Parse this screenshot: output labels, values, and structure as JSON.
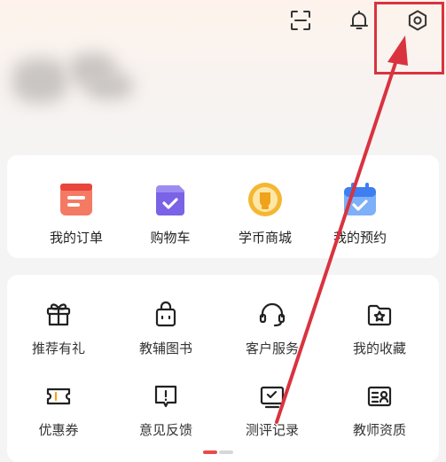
{
  "icons": {
    "scan": "scan-icon",
    "bell": "bell-icon",
    "gear": "gear-icon"
  },
  "orders": [
    {
      "label": "我的订单",
      "icon": "order-icon",
      "color": "#e8453c"
    },
    {
      "label": "购物车",
      "icon": "cart-icon",
      "color": "#7a63e6"
    },
    {
      "label": "学币商城",
      "icon": "coin-icon",
      "color": "#f2a31b"
    },
    {
      "label": "我的预约",
      "icon": "calendar-icon",
      "color": "#3d7ff1"
    }
  ],
  "services": [
    {
      "label": "推荐有礼",
      "icon": "gift-icon"
    },
    {
      "label": "教辅图书",
      "icon": "bag-icon"
    },
    {
      "label": "客户服务",
      "icon": "headset-icon"
    },
    {
      "label": "我的收藏",
      "icon": "favorite-folder-icon"
    },
    {
      "label": "优惠券",
      "icon": "coupon-icon"
    },
    {
      "label": "意见反馈",
      "icon": "feedback-icon"
    },
    {
      "label": "测评记录",
      "icon": "test-record-icon"
    },
    {
      "label": "教师资质",
      "icon": "teacher-certificate-icon"
    }
  ],
  "colors": {
    "accent": "#e94a4a",
    "annotation": "#d9333f"
  }
}
